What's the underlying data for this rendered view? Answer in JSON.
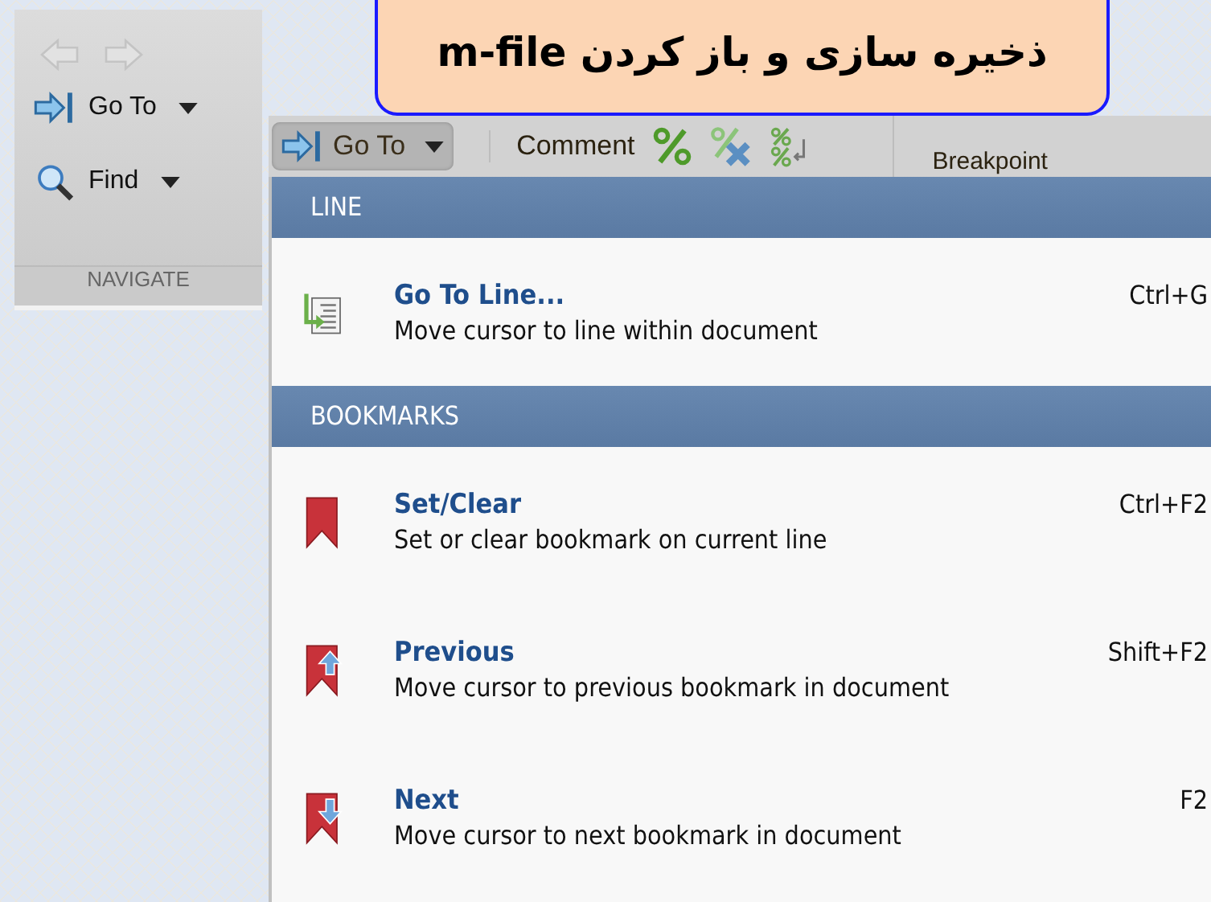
{
  "title_banner": {
    "text": "ذخیره سازی و باز کردن m-file"
  },
  "navigate_panel": {
    "history_buttons": [
      {
        "kind": "back",
        "disabled": true
      },
      {
        "kind": "forward",
        "disabled": true
      }
    ],
    "buttons": [
      {
        "kind": "goto",
        "label": "Go To"
      },
      {
        "kind": "find",
        "label": "Find"
      }
    ],
    "section_label": "NAVIGATE"
  },
  "toolbar": {
    "goto_button": {
      "label": "Go To",
      "pressed": true
    },
    "comment_label": "Comment",
    "comment_icons": [
      {
        "kind": "comment"
      },
      {
        "kind": "uncomment"
      },
      {
        "kind": "wrap"
      }
    ],
    "column_label": "Breakpoint"
  },
  "menu": {
    "sections": [
      {
        "header": "LINE",
        "items": [
          {
            "kind": "goto-line",
            "title": "Go To Line...",
            "description": "Move cursor to line within document",
            "shortcut": "Ctrl+G"
          }
        ]
      },
      {
        "header": "BOOKMARKS",
        "items": [
          {
            "kind": "bookmark",
            "title": "Set/Clear",
            "description": "Set or clear bookmark on current line",
            "shortcut": "Ctrl+F2"
          },
          {
            "kind": "bookmark-previous",
            "title": "Previous",
            "description": "Move cursor to previous bookmark in document",
            "shortcut": "Shift+F2"
          },
          {
            "kind": "bookmark-next",
            "title": "Next",
            "description": "Move cursor to next bookmark in document",
            "shortcut": "F2"
          }
        ]
      }
    ]
  }
}
